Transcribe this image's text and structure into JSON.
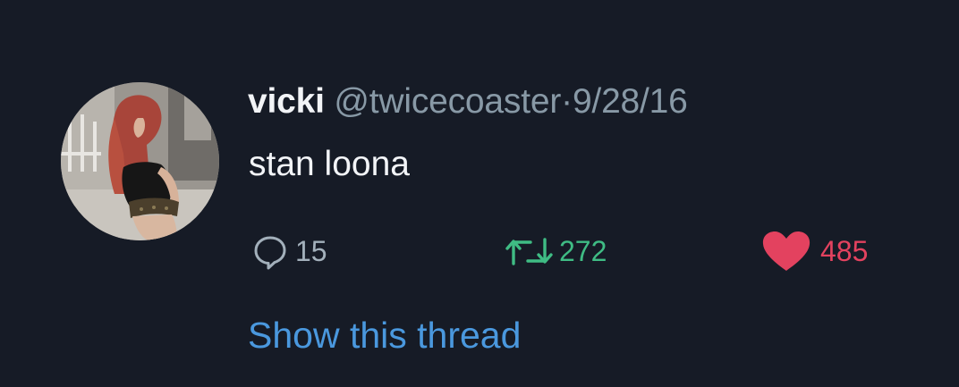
{
  "tweet": {
    "display_name": "vicki",
    "handle": "@twicecoaster",
    "separator": "·",
    "date": "9/28/16",
    "text": "stan loona",
    "avatar_icon": "profile-photo"
  },
  "actions": {
    "reply": {
      "icon": "reply-icon",
      "count": "15",
      "color": "#8899a6"
    },
    "retweet": {
      "icon": "retweet-icon",
      "count": "272",
      "color": "#3fbc84"
    },
    "like": {
      "icon": "heart-icon",
      "count": "485",
      "color": "#e0245e"
    }
  },
  "show_thread_label": "Show this thread",
  "colors": {
    "background": "#161b26",
    "link": "#4a98de",
    "muted": "#8899a6"
  }
}
